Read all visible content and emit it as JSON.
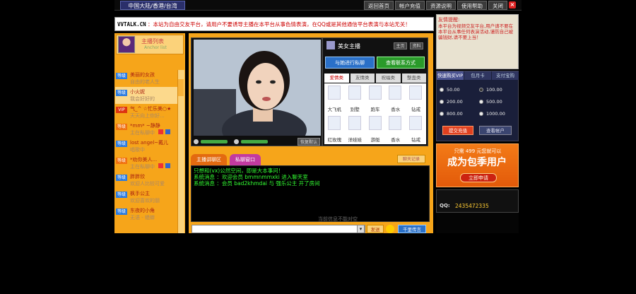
{
  "topbar": {
    "region": "中国大陆/香港/台湾",
    "nav": [
      "返回首页",
      "帐户充值",
      "资源说明",
      "使用帮助",
      "关闭"
    ],
    "close_glyph": "×"
  },
  "notice": {
    "logo": "VVTALK.CN",
    "text": "：本站为自由交友平台，请用户不要诱导主播在本平台从事色情表演，在QQ或是其他通信平台表演与本站无关！"
  },
  "sidebar": {
    "title": "主播列表",
    "subtitle": "Anchor list",
    "users": [
      {
        "badge": "等级",
        "badge_color": "blue",
        "name": "美丽的女孩",
        "status": "自由的老人生"
      },
      {
        "badge": "等级",
        "badge_color": "blue",
        "name": "小火妮",
        "status": "我会好好的",
        "selected": true
      },
      {
        "badge": "VIP",
        "badge_color": "red",
        "name": "气_^ ☆忙乐美○★",
        "status": "天天向上你好..."
      },
      {
        "badge": "等级",
        "badge_color": "orange",
        "name": "*mm* ~静静",
        "status": "主在私聊中",
        "icons": true
      },
      {
        "badge": "等级",
        "badge_color": "blue",
        "name": "lost angel~戴儿",
        "status": "唱歌中"
      },
      {
        "badge": "等级",
        "badge_color": "orange",
        "name": "*劝你美人...",
        "status": "主在私聊中",
        "icons": true
      },
      {
        "badge": "等级",
        "badge_color": "blue",
        "name": "胖胖欣",
        "status": "欢迎人比较可爱"
      },
      {
        "badge": "等级",
        "badge_color": "blue",
        "name": "枫手公主",
        "status": "欢迎喜欢的朋"
      },
      {
        "badge": "等级",
        "badge_color": "blue",
        "name": "东夜的小角",
        "status": "无语 - 蟋蟀"
      }
    ]
  },
  "video": {
    "restore_label": "恢复默认"
  },
  "giftbox": {
    "title": "美女主播",
    "mini_buttons": [
      "主页",
      "资料"
    ],
    "private_label": "与她进行私聊",
    "contact_label": "查看联系方式",
    "tabs": [
      "爱情类",
      "友情类",
      "祝福类",
      "整蛊类"
    ],
    "active_tab": 0,
    "gifts": [
      "大飞机",
      "别墅",
      "跑车",
      "香水",
      "钻戒",
      "红玫瑰",
      "洋娃娃",
      "游艇",
      "香水",
      "钻戒"
    ]
  },
  "chat": {
    "tab_public": "主播讲聊区",
    "tab_private": "私聊窗口",
    "history_label": "聊天记录",
    "lines": [
      "只想和(vx)公然空间，即是大本事问！",
      "系统消息 ：欢迎会员 bmmnmmxki 进入聊天室",
      "系统消息 ：会员 bad2khmdai 与 强乐公主 开了房间"
    ],
    "hint": "当前信息不能对空",
    "send_label": "发送",
    "hand_label": "千里传言"
  },
  "friend": {
    "title": "友情提醒:",
    "text": "本平台为视频交友平台,用户请不要在本平台从事任何表演活动,谨防自己被骗钱财,请不要上当！"
  },
  "recharge": {
    "tabs": [
      "快速购买VIP",
      "包月卡",
      "支付宝购"
    ],
    "options": [
      "50.00",
      "100.00",
      "200.00",
      "500.00",
      "800.00",
      "1000.00"
    ],
    "selected_index": 1,
    "submit_label": "提交充值",
    "account_label": "查看帐户"
  },
  "promo": {
    "line1": "只需 499 元您就可以",
    "line2": "成为包季用户",
    "apply_label": "立即申请"
  },
  "qq": {
    "label": "QQ:",
    "number": "2435472335"
  }
}
